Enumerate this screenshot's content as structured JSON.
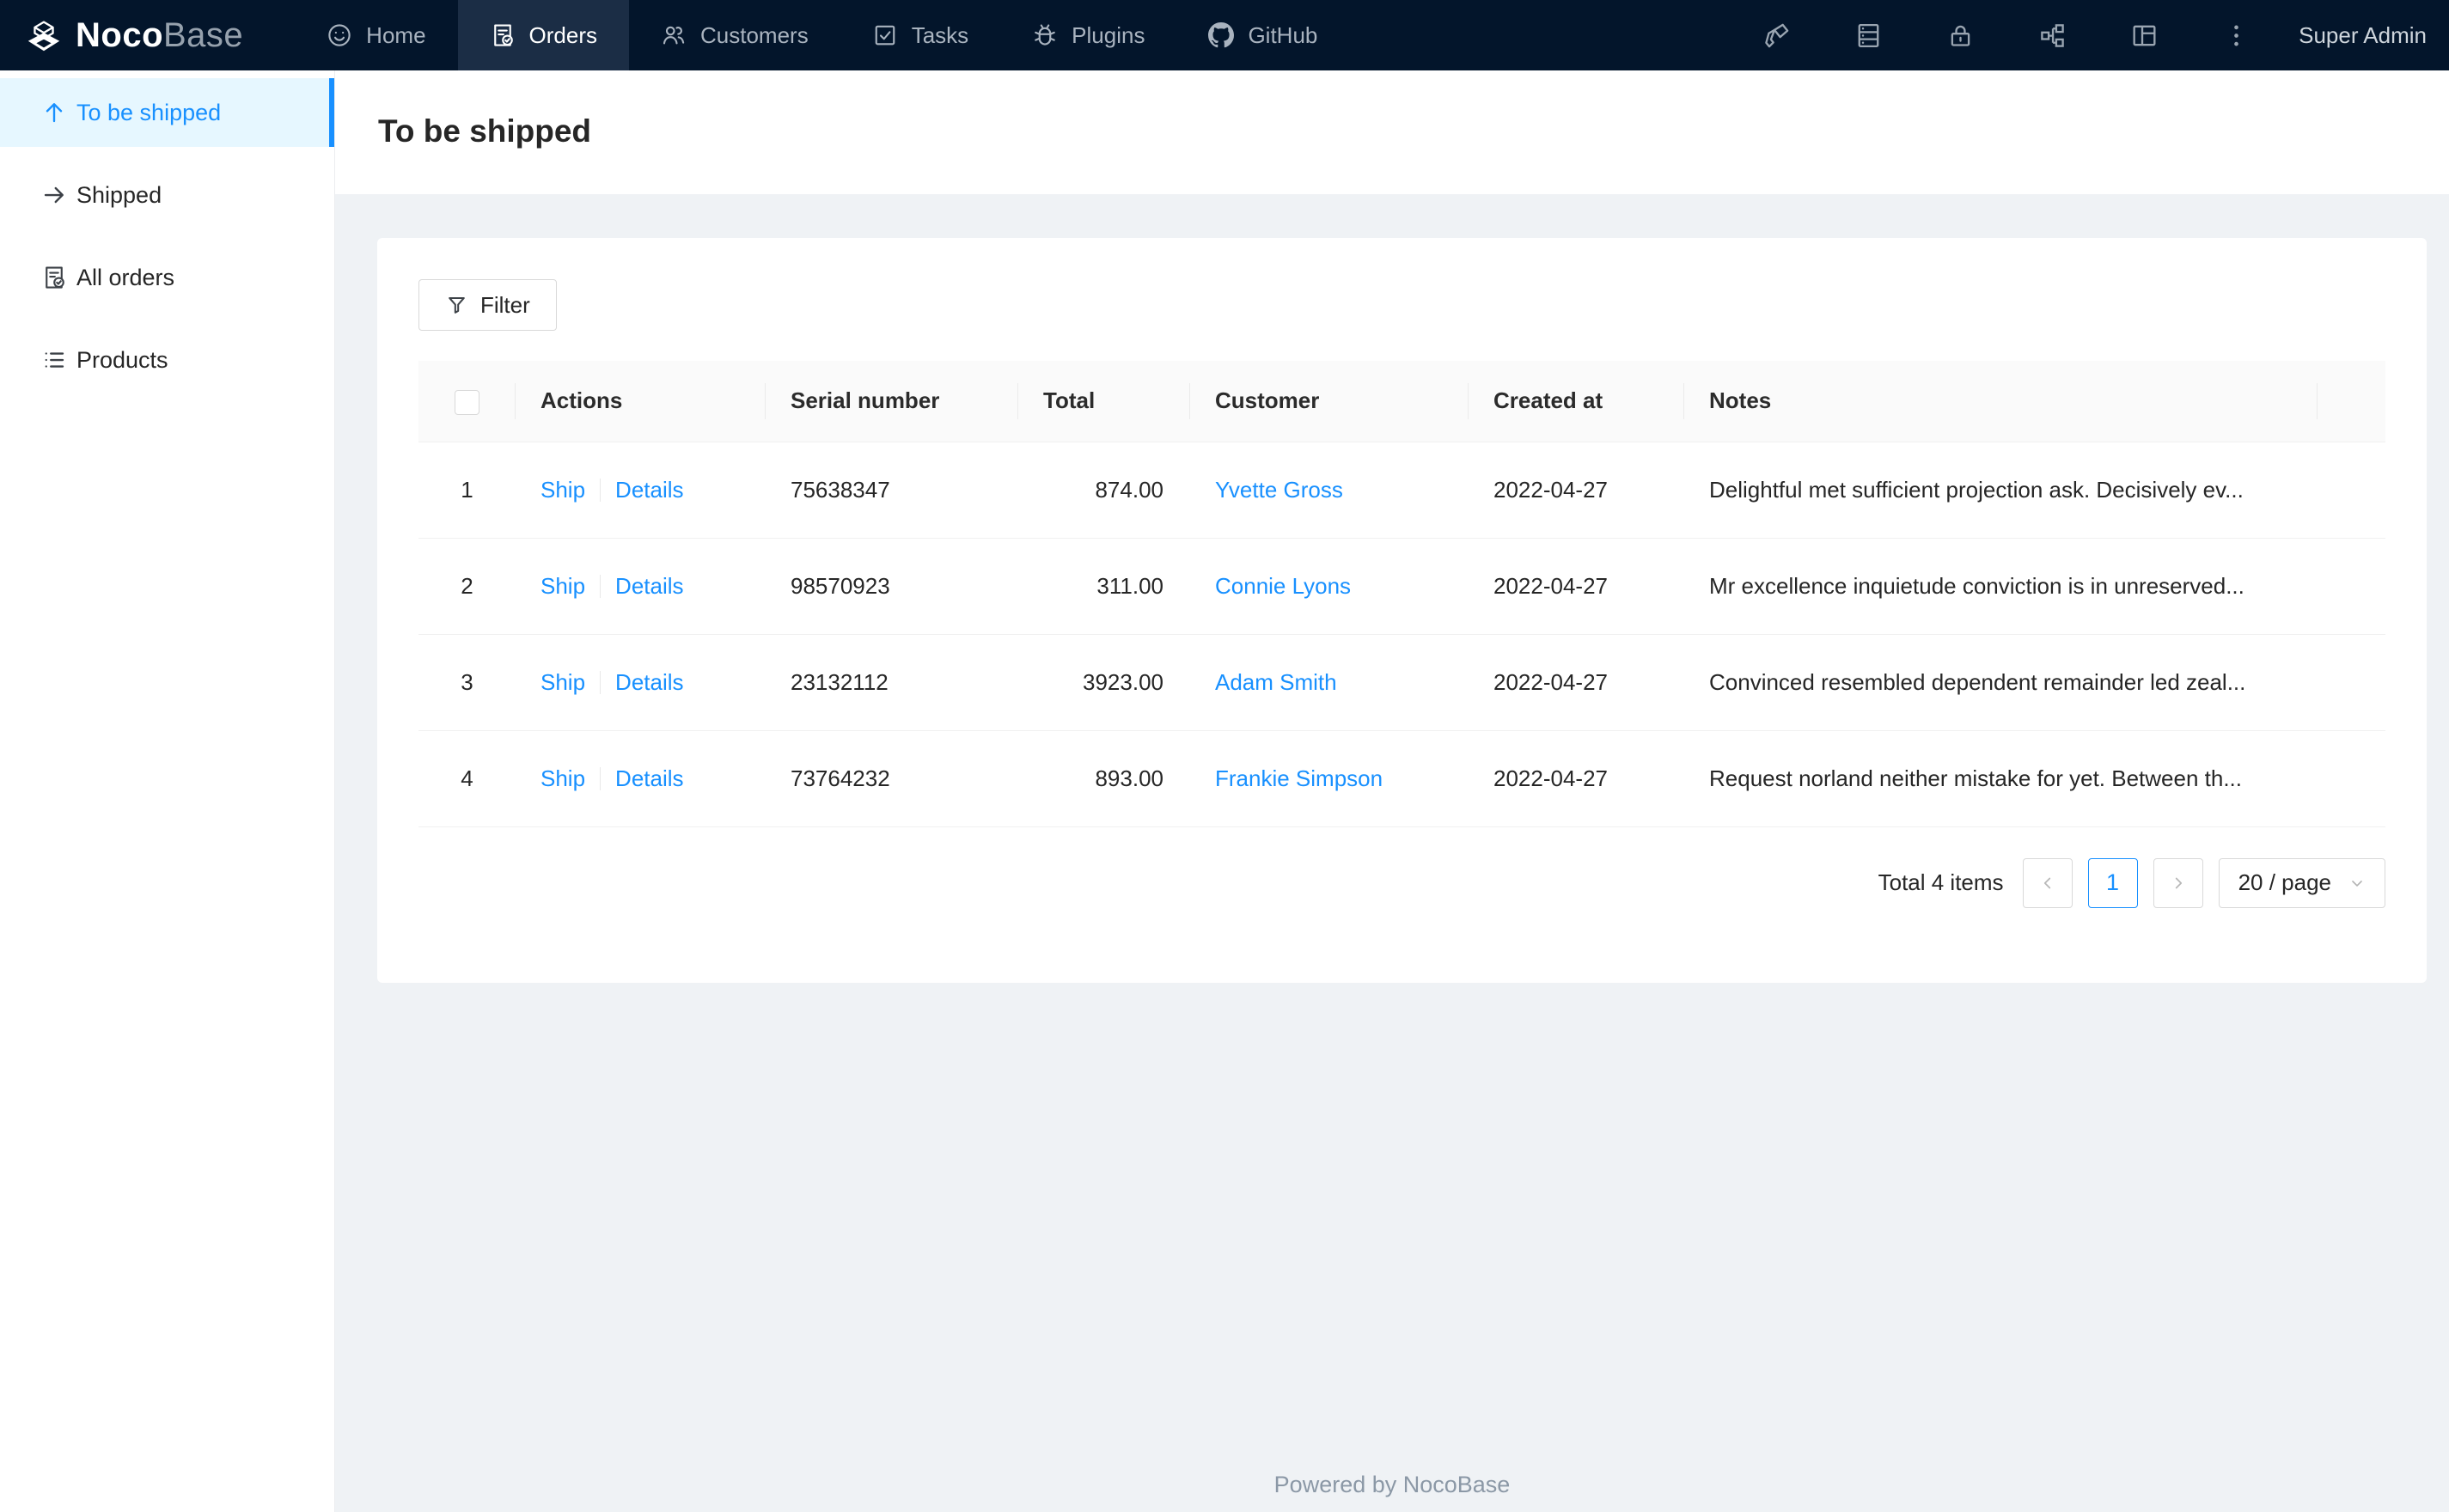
{
  "nav": {
    "logo": {
      "bold": "Noco",
      "light": "Base"
    },
    "items": [
      {
        "label": "Home"
      },
      {
        "label": "Orders",
        "active": true
      },
      {
        "label": "Customers"
      },
      {
        "label": "Tasks"
      },
      {
        "label": "Plugins"
      },
      {
        "label": "GitHub"
      }
    ],
    "user": "Super Admin"
  },
  "sidebar": {
    "items": [
      {
        "label": "To be shipped",
        "active": true
      },
      {
        "label": "Shipped"
      },
      {
        "label": "All orders"
      },
      {
        "label": "Products"
      }
    ]
  },
  "page": {
    "title": "To be shipped"
  },
  "toolbar": {
    "filter_label": "Filter"
  },
  "table": {
    "headers": [
      "Actions",
      "Serial number",
      "Total",
      "Customer",
      "Created at",
      "Notes"
    ],
    "actions": {
      "ship": "Ship",
      "details": "Details"
    },
    "rows": [
      {
        "index": "1",
        "serial": "75638347",
        "total": "874.00",
        "customer": "Yvette Gross",
        "created_at": "2022-04-27",
        "notes": "Delightful met sufficient projection ask. Decisively ev..."
      },
      {
        "index": "2",
        "serial": "98570923",
        "total": "311.00",
        "customer": "Connie Lyons",
        "created_at": "2022-04-27",
        "notes": "Mr excellence inquietude conviction is in unreserved..."
      },
      {
        "index": "3",
        "serial": "23132112",
        "total": "3923.00",
        "customer": "Adam Smith",
        "created_at": "2022-04-27",
        "notes": "Convinced resembled dependent remainder led zeal..."
      },
      {
        "index": "4",
        "serial": "73764232",
        "total": "893.00",
        "customer": "Frankie Simpson",
        "created_at": "2022-04-27",
        "notes": "Request norland neither mistake for yet. Between th..."
      }
    ]
  },
  "pagination": {
    "total_text": "Total 4 items",
    "page": "1",
    "page_size": "20 / page"
  },
  "footer": {
    "text": "Powered by NocoBase"
  },
  "colors": {
    "primary": "#1890ff",
    "nav_bg": "#03152b",
    "nav_active_bg": "#1b2d45",
    "selected_bg": "#e6f7ff",
    "page_bg": "#eff2f5"
  }
}
